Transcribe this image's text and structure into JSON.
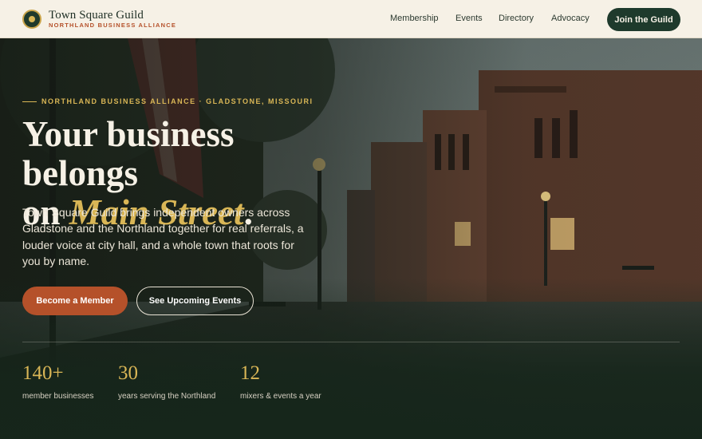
{
  "brand": {
    "name": "Town Square Guild",
    "subtitle": "NORTHLAND BUSINESS ALLIANCE",
    "logo_icon": "town-seal-icon"
  },
  "nav": {
    "items": [
      {
        "label": "Membership"
      },
      {
        "label": "Events"
      },
      {
        "label": "Directory"
      },
      {
        "label": "Advocacy"
      }
    ],
    "cta_label": "Join the Guild"
  },
  "hero": {
    "eyebrow": "NORTHLAND BUSINESS ALLIANCE · GLADSTONE, MISSOURI",
    "headline_line1": "Your business belongs",
    "headline_line2_prefix": "on ",
    "headline_accent": "Main Street",
    "headline_suffix": ".",
    "lede": "Town Square Guild brings independent owners across Gladstone and the Northland together for real referrals, a louder voice at city hall, and a whole town that roots for you by name.",
    "primary_button": "Become a Member",
    "secondary_button": "See Upcoming Events"
  },
  "stats": [
    {
      "value": "140+",
      "label": "member businesses"
    },
    {
      "value": "30",
      "label": "years serving the Northland"
    },
    {
      "value": "12",
      "label": "mixers & events a year"
    }
  ],
  "colors": {
    "header_bg": "#f6f1e6",
    "brand_green": "#1e3a2c",
    "accent_gold": "#d9b656",
    "accent_rust": "#b5512a"
  }
}
